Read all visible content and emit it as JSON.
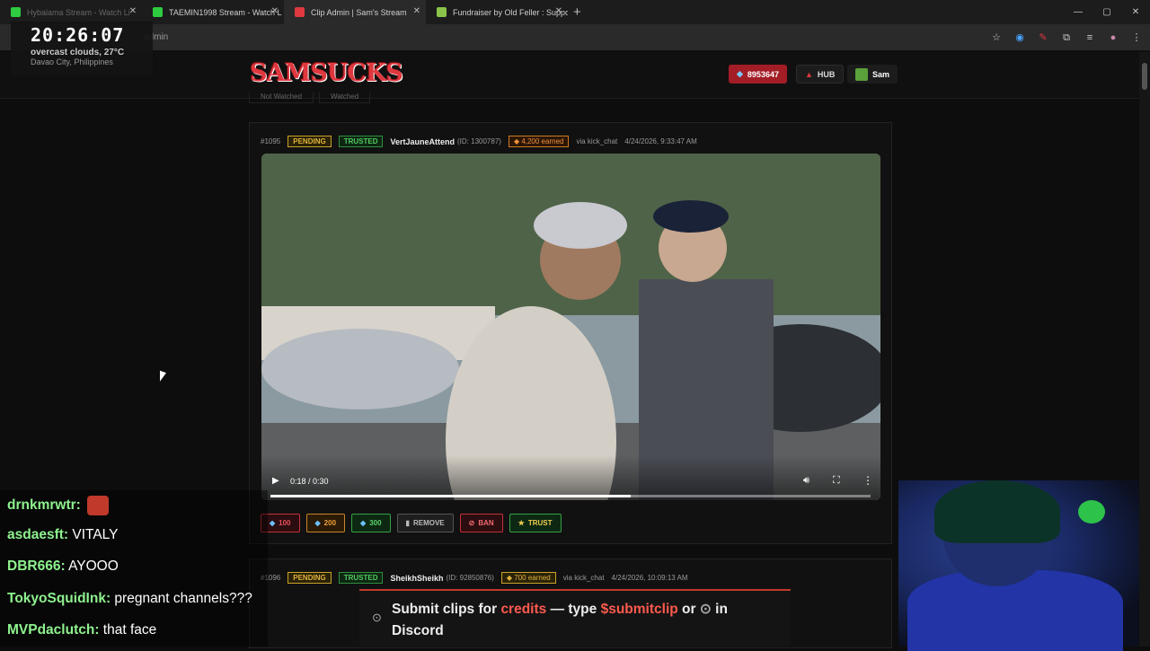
{
  "browser": {
    "tabs": [
      {
        "label": "Hybalama Stream - Watch Li",
        "favicon_color": "#2ecc40"
      },
      {
        "label": "TAEMIN1998 Stream - Watch L",
        "favicon_color": "#2ecc40"
      },
      {
        "label": "Clip Admin | Sam's Stream",
        "favicon_color": "#e0383f"
      },
      {
        "label": "Fundraiser by Old Feller : Suppo",
        "favicon_color": "#8bc34a"
      }
    ],
    "new_tab_label": "+",
    "url": "admin",
    "window_controls": {
      "minimize": "—",
      "maximize": "▢",
      "close": "✕"
    }
  },
  "clock_overlay": {
    "time": "20:26:07",
    "conditions": "overcast clouds, 27°C",
    "location": "Davao City, Philippines"
  },
  "site": {
    "logo_text": "SAMSUCKS",
    "credits_balance": "8953647",
    "hub_label": "HUB",
    "user_label": "Sam",
    "filters": [
      "Not Watched",
      "Watched"
    ]
  },
  "clips": [
    {
      "id": "#1095",
      "status": "PENDING",
      "trust": "TRUSTED",
      "username": "VertJauneAttend",
      "user_id": "(ID: 1300787)",
      "earned": "4,200 earned",
      "via": "via kick_chat",
      "timestamp": "4/24/2026, 9:33:47 AM",
      "video_time": "0:18 / 0:30",
      "progress": 0.6,
      "actions": {
        "a100": "100",
        "a200": "200",
        "a300": "300",
        "remove": "REMOVE",
        "ban": "BAN",
        "trust": "TRUST"
      }
    },
    {
      "id": "#1096",
      "status": "PENDING",
      "trust": "TRUSTED",
      "username": "SheikhSheikh",
      "user_id": "(ID: 92850876)",
      "earned": "700 earned",
      "via": "via kick_chat",
      "timestamp": "4/24/2026, 10:09:13 AM"
    }
  ],
  "chat": [
    {
      "user": "drnkmrwtr:",
      "message": ""
    },
    {
      "user": "asdaesft:",
      "message": "VITALY"
    },
    {
      "user": "DBR666:",
      "message": "AYOOO"
    },
    {
      "user": "TokyoSquidInk:",
      "message": "pregnant channels???"
    },
    {
      "user": "MVPdaclutch:",
      "message": "that face"
    }
  ],
  "notification": {
    "part1": "Submit clips for",
    "credits_word": "credits",
    "part2": "— type",
    "command": "$submitclip",
    "part3": "or",
    "part4": "in Discord"
  }
}
